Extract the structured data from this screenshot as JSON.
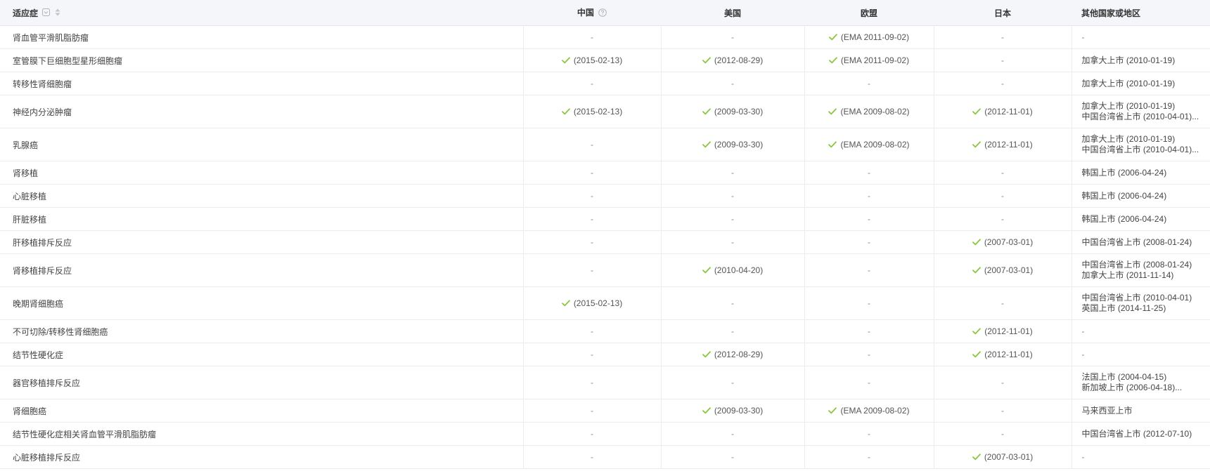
{
  "columns": {
    "indication": "适应症",
    "china": "中国",
    "usa": "美国",
    "eu": "欧盟",
    "japan": "日本",
    "other": "其他国家或地区"
  },
  "colors": {
    "check": "#8cc63f",
    "header_bg": "#f5f6f9",
    "border": "#ececec"
  },
  "icons": {
    "filter": "filter-icon",
    "sort": "sort-icon",
    "help": "help-circle-icon",
    "check": "checkmark-icon"
  },
  "rows": [
    {
      "indication": "肾血管平滑肌脂肪瘤",
      "china": "-",
      "usa": "-",
      "eu": "(EMA 2011-09-02)",
      "japan": "-",
      "other": [
        "-"
      ]
    },
    {
      "indication": "室管膜下巨细胞型星形细胞瘤",
      "china": "(2015-02-13)",
      "usa": "(2012-08-29)",
      "eu": "(EMA 2011-09-02)",
      "japan": "-",
      "other": [
        "加拿大上市 (2010-01-19)"
      ]
    },
    {
      "indication": "转移性肾细胞瘤",
      "china": "-",
      "usa": "-",
      "eu": "-",
      "japan": "-",
      "other": [
        "加拿大上市 (2010-01-19)"
      ]
    },
    {
      "indication": "神经内分泌肿瘤",
      "china": "(2015-02-13)",
      "usa": "(2009-03-30)",
      "eu": "(EMA 2009-08-02)",
      "japan": "(2012-11-01)",
      "other": [
        "加拿大上市 (2010-01-19)",
        "中国台湾省上市 (2010-04-01)..."
      ]
    },
    {
      "indication": "乳腺癌",
      "china": "-",
      "usa": "(2009-03-30)",
      "eu": "(EMA 2009-08-02)",
      "japan": "(2012-11-01)",
      "other": [
        "加拿大上市 (2010-01-19)",
        "中国台湾省上市 (2010-04-01)..."
      ]
    },
    {
      "indication": "肾移植",
      "china": "-",
      "usa": "-",
      "eu": "-",
      "japan": "-",
      "other": [
        "韩国上市 (2006-04-24)"
      ]
    },
    {
      "indication": "心脏移植",
      "china": "-",
      "usa": "-",
      "eu": "-",
      "japan": "-",
      "other": [
        "韩国上市 (2006-04-24)"
      ]
    },
    {
      "indication": "肝脏移植",
      "china": "-",
      "usa": "-",
      "eu": "-",
      "japan": "-",
      "other": [
        "韩国上市 (2006-04-24)"
      ]
    },
    {
      "indication": "肝移植排斥反应",
      "china": "-",
      "usa": "-",
      "eu": "-",
      "japan": "(2007-03-01)",
      "other": [
        "中国台湾省上市 (2008-01-24)"
      ]
    },
    {
      "indication": "肾移植排斥反应",
      "china": "-",
      "usa": "(2010-04-20)",
      "eu": "-",
      "japan": "(2007-03-01)",
      "other": [
        "中国台湾省上市 (2008-01-24)",
        "加拿大上市 (2011-11-14)"
      ]
    },
    {
      "indication": "晚期肾细胞癌",
      "china": "(2015-02-13)",
      "usa": "-",
      "eu": "-",
      "japan": "-",
      "other": [
        "中国台湾省上市 (2010-04-01)",
        "英国上市 (2014-11-25)"
      ]
    },
    {
      "indication": "不可切除/转移性肾细胞癌",
      "china": "-",
      "usa": "-",
      "eu": "-",
      "japan": "(2012-11-01)",
      "other": [
        "-"
      ]
    },
    {
      "indication": "结节性硬化症",
      "china": "-",
      "usa": "(2012-08-29)",
      "eu": "-",
      "japan": "(2012-11-01)",
      "other": [
        "-"
      ]
    },
    {
      "indication": "器官移植排斥反应",
      "china": "-",
      "usa": "-",
      "eu": "-",
      "japan": "-",
      "other": [
        "法国上市 (2004-04-15)",
        "新加坡上市 (2006-04-18)..."
      ]
    },
    {
      "indication": "肾细胞癌",
      "china": "-",
      "usa": "(2009-03-30)",
      "eu": "(EMA 2009-08-02)",
      "japan": "-",
      "other": [
        "马来西亚上市"
      ]
    },
    {
      "indication": "结节性硬化症相关肾血管平滑肌脂肪瘤",
      "china": "-",
      "usa": "-",
      "eu": "-",
      "japan": "-",
      "other": [
        "中国台湾省上市 (2012-07-10)"
      ]
    },
    {
      "indication": "心脏移植排斥反应",
      "china": "-",
      "usa": "-",
      "eu": "-",
      "japan": "(2007-03-01)",
      "other": [
        "-"
      ]
    }
  ]
}
